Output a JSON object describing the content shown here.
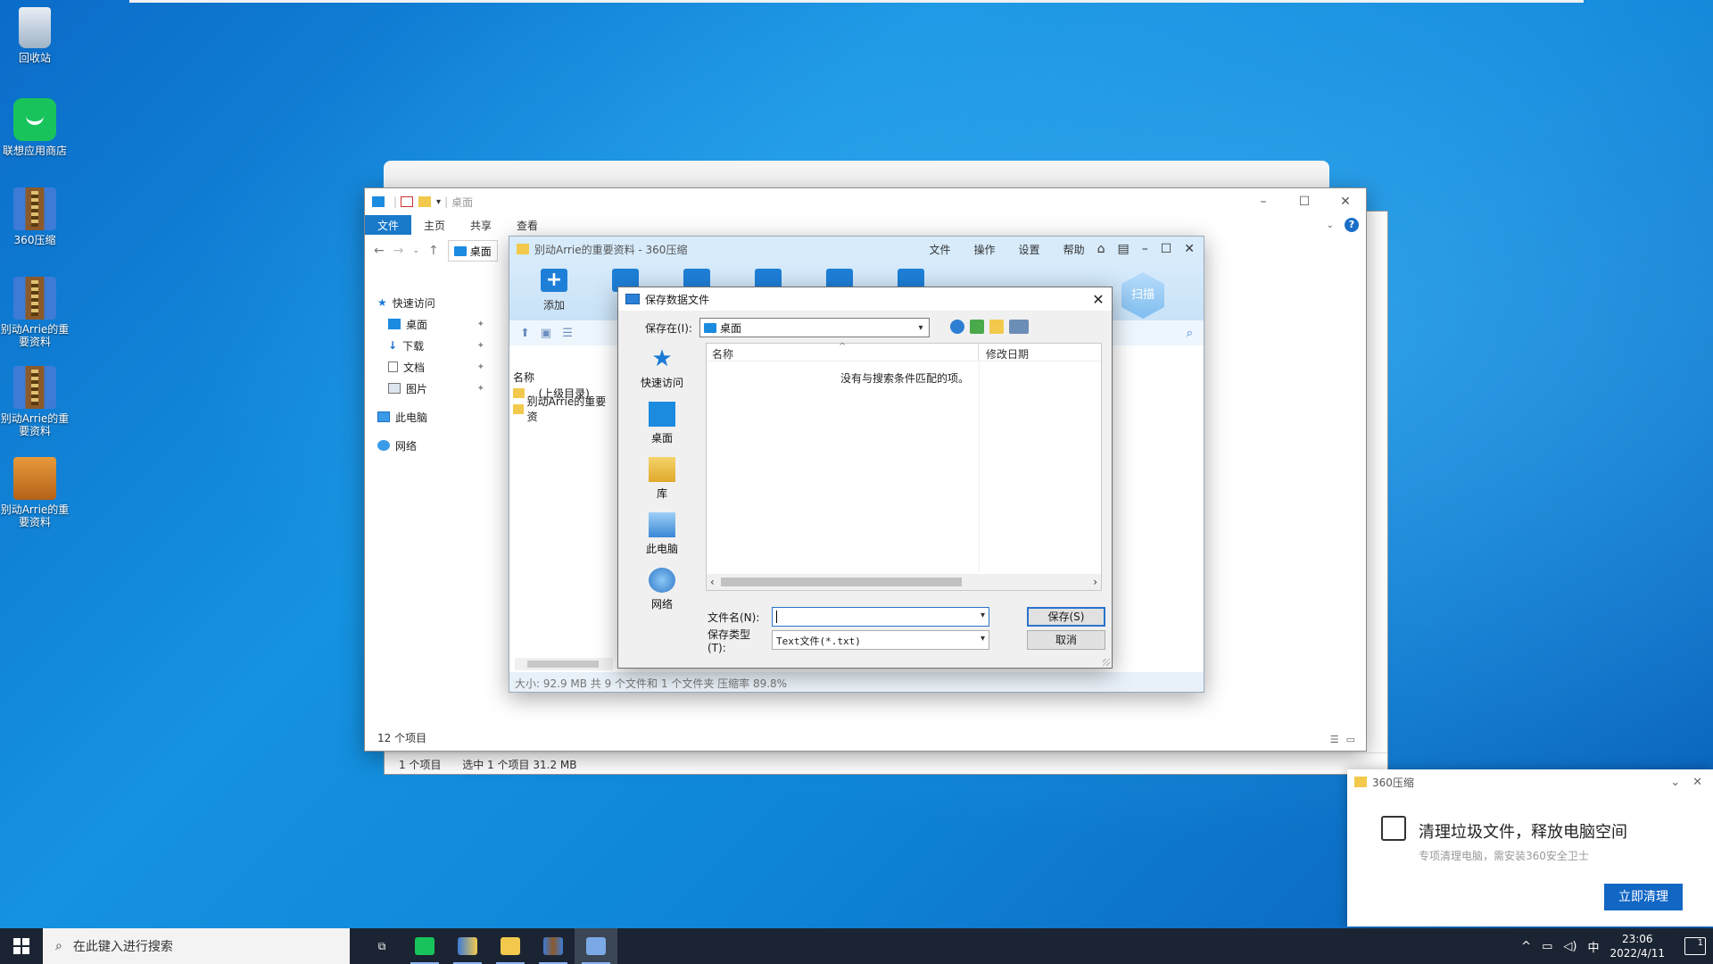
{
  "desktop": {
    "icons": [
      {
        "label": "回收站"
      },
      {
        "label": "联想应用商店"
      },
      {
        "label": "360压缩"
      },
      {
        "label": "别动Arrie的重要资料"
      },
      {
        "label": "别动Arrie的重要资料"
      },
      {
        "label": "别动Arrie的重要资料"
      }
    ]
  },
  "back_window": {
    "status_items": "1 个项目",
    "status_selected": "选中 1 个项目  31.2 MB"
  },
  "explorer": {
    "title": "桌面",
    "ribbon_tabs": [
      "文件",
      "主页",
      "共享",
      "查看"
    ],
    "address": "桌面",
    "sidebar": {
      "quick_access": "快速访问",
      "desktop": "桌面",
      "downloads": "下载",
      "documents": "文档",
      "pictures": "图片",
      "this_pc": "此电脑",
      "network": "网络"
    },
    "footer_count": "12 个项目"
  },
  "zip_window": {
    "title": "别动Arrie的重要资料 - 360压缩",
    "menu": [
      "文件",
      "操作",
      "设置",
      "帮助"
    ],
    "add_label": "添加",
    "scan_label": "扫描",
    "list_header": "名称",
    "list_items": [
      ".. (上级目录)",
      "别动Arrie的重要资"
    ],
    "status": "大小: 92.9 MB 共 9 个文件和 1 个文件夹 压缩率 89.8%"
  },
  "save_dialog": {
    "title": "保存数据文件",
    "save_in_label": "保存在(I):",
    "save_in_value": "桌面",
    "places": [
      "快速访问",
      "桌面",
      "库",
      "此电脑",
      "网络"
    ],
    "col_name": "名称",
    "col_modified": "修改日期",
    "empty_message": "没有与搜索条件匹配的项。",
    "filename_label": "文件名(N):",
    "filename_value": "",
    "filetype_label": "保存类型(T):",
    "filetype_value": "Text文件(*.txt)",
    "save_button": "保存(S)",
    "cancel_button": "取消"
  },
  "notification": {
    "app": "360压缩",
    "title": "清理垃圾文件，释放电脑空间",
    "subtitle": "专项清理电脑，需安装360安全卫士",
    "button": "立即清理"
  },
  "taskbar": {
    "search_placeholder": "在此键入进行搜索",
    "ime": "中",
    "time": "23:06",
    "date": "2022/4/11",
    "notif_count": "1"
  },
  "colors": {
    "accent": "#1979ca",
    "wallpaper": "#0f86d8",
    "taskbar": "#1b2432",
    "notify_button": "#1266c4"
  }
}
